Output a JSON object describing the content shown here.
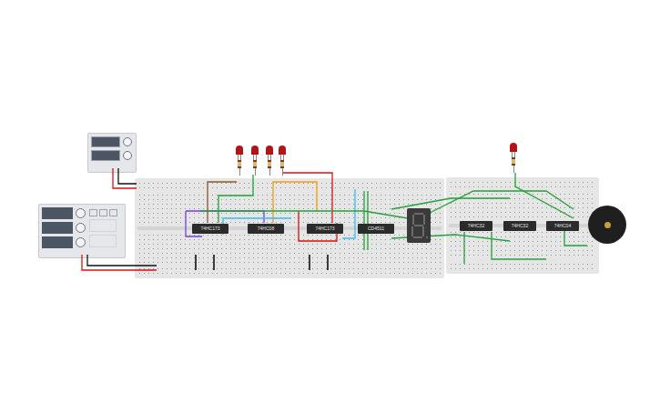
{
  "circuit": {
    "chips": [
      {
        "label": "74HC173"
      },
      {
        "label": "74HC08"
      },
      {
        "label": "74HC173"
      },
      {
        "label": "CD4511"
      },
      {
        "label": "74HC32"
      },
      {
        "label": "74HC32"
      },
      {
        "label": "74HC04"
      }
    ],
    "leds": [
      {
        "on": false
      },
      {
        "on": false
      },
      {
        "on": false
      },
      {
        "on": false
      },
      {
        "on": false
      }
    ],
    "seven_segment": {
      "lit": false
    }
  }
}
